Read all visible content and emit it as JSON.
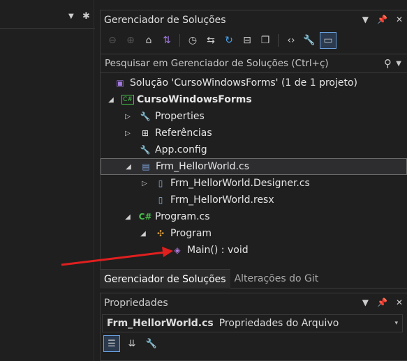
{
  "solution_explorer": {
    "title": "Gerenciador de Soluções",
    "search_placeholder": "Pesquisar em Gerenciador de Soluções (Ctrl+ç)",
    "tree": {
      "solution": "Solução 'CursoWindowsForms' (1 de 1 projeto)",
      "project": "CursoWindowsForms",
      "properties": "Properties",
      "references": "Referências",
      "app_config": "App.config",
      "form": "Frm_HellorWorld.cs",
      "designer": "Frm_HellorWorld.Designer.cs",
      "resx": "Frm_HellorWorld.resx",
      "program_cs": "Program.cs",
      "program_class": "Program",
      "main_method": "Main() : void"
    }
  },
  "tabs": [
    "Gerenciador de Soluções",
    "Alterações do Git"
  ],
  "properties": {
    "title": "Propriedades",
    "object_name": "Frm_HellorWorld.cs",
    "object_type": "Propriedades do Arquivo"
  },
  "icons": {
    "csharp_badge": "C#"
  },
  "colors": {
    "accent": "#8a5cd1",
    "annotation_arrow": "#e01f1f"
  }
}
